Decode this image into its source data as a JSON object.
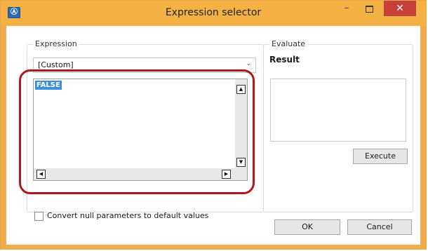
{
  "window": {
    "title": "Expression selector",
    "app_icon": "Ⓐ",
    "minimize_glyph": "–",
    "close_glyph": "✕"
  },
  "expression": {
    "group_title": "Expression",
    "combo_value": "[Custom]",
    "combo_arrow": "⌄",
    "editor_text": "FALSE",
    "convert_label": "Convert null parameters to default values",
    "convert_checked": false
  },
  "evaluate": {
    "group_title": "Evaluate",
    "result_label": "Result",
    "execute_label": "Execute"
  },
  "buttons": {
    "ok_label": "OK",
    "cancel_label": "Cancel"
  },
  "scroll_glyphs": {
    "up": "▲",
    "down": "▼",
    "left": "◀",
    "right": "▶"
  },
  "colors": {
    "title_bar": "#f4b144",
    "close_button": "#c7413a",
    "highlight_outline": "#b0181c",
    "token_highlight": "#3f8fd8"
  }
}
